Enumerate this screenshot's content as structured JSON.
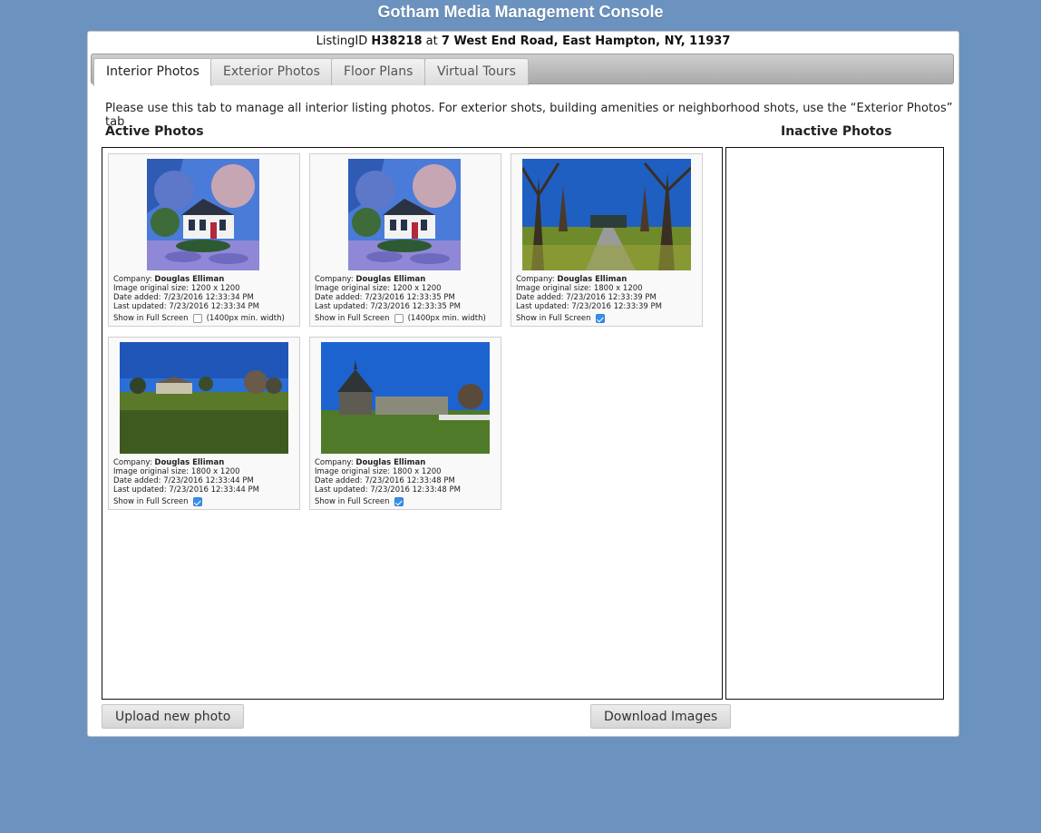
{
  "app": {
    "title": "Gotham Media Management Console"
  },
  "listing": {
    "prefix": "ListingID",
    "id": "H38218",
    "at": "at",
    "address": "7 West End Road, East Hampton, NY, 11937"
  },
  "tabs": [
    {
      "label": "Interior Photos",
      "active": true
    },
    {
      "label": "Exterior Photos",
      "active": false
    },
    {
      "label": "Floor Plans",
      "active": false
    },
    {
      "label": "Virtual Tours",
      "active": false
    }
  ],
  "description": "Please use this tab to manage all interior listing photos. For exterior shots, building amenities or neighborhood shots, use the “Exterior Photos” tab",
  "sections": {
    "active": "Active Photos",
    "inactive": "Inactive Photos"
  },
  "photo_labels": {
    "company": "Company:",
    "size": "Image original size:",
    "added": "Date added:",
    "updated": "Last updated:",
    "fullscreen": "Show in Full Screen",
    "min_width_note": "(1400px min. width)"
  },
  "photos": [
    {
      "company": "Douglas Elliman",
      "size": "1200 x 1200",
      "added": "7/23/2016 12:33:34 PM",
      "updated": "7/23/2016 12:33:34 PM",
      "fullscreen": false,
      "image": "colonial-house-snow"
    },
    {
      "company": "Douglas Elliman",
      "size": "1200 x 1200",
      "added": "7/23/2016 12:33:35 PM",
      "updated": "7/23/2016 12:33:35 PM",
      "fullscreen": false,
      "image": "colonial-house-snow"
    },
    {
      "company": "Douglas Elliman",
      "size": "1800 x 1200",
      "added": "7/23/2016 12:33:39 PM",
      "updated": "7/23/2016 12:33:39 PM",
      "fullscreen": true,
      "image": "tree-lined-driveway"
    },
    {
      "company": "Douglas Elliman",
      "size": "1800 x 1200",
      "added": "7/23/2016 12:33:44 PM",
      "updated": "7/23/2016 12:33:44 PM",
      "fullscreen": true,
      "image": "lawn-estate"
    },
    {
      "company": "Douglas Elliman",
      "size": "1800 x 1200",
      "added": "7/23/2016 12:33:48 PM",
      "updated": "7/23/2016 12:33:48 PM",
      "fullscreen": true,
      "image": "gazebo-estate"
    }
  ],
  "buttons": {
    "upload": "Upload new photo",
    "download": "Download Images"
  },
  "colors": {
    "background": "#6c93bf",
    "checkbox": "#3a8ee6"
  }
}
